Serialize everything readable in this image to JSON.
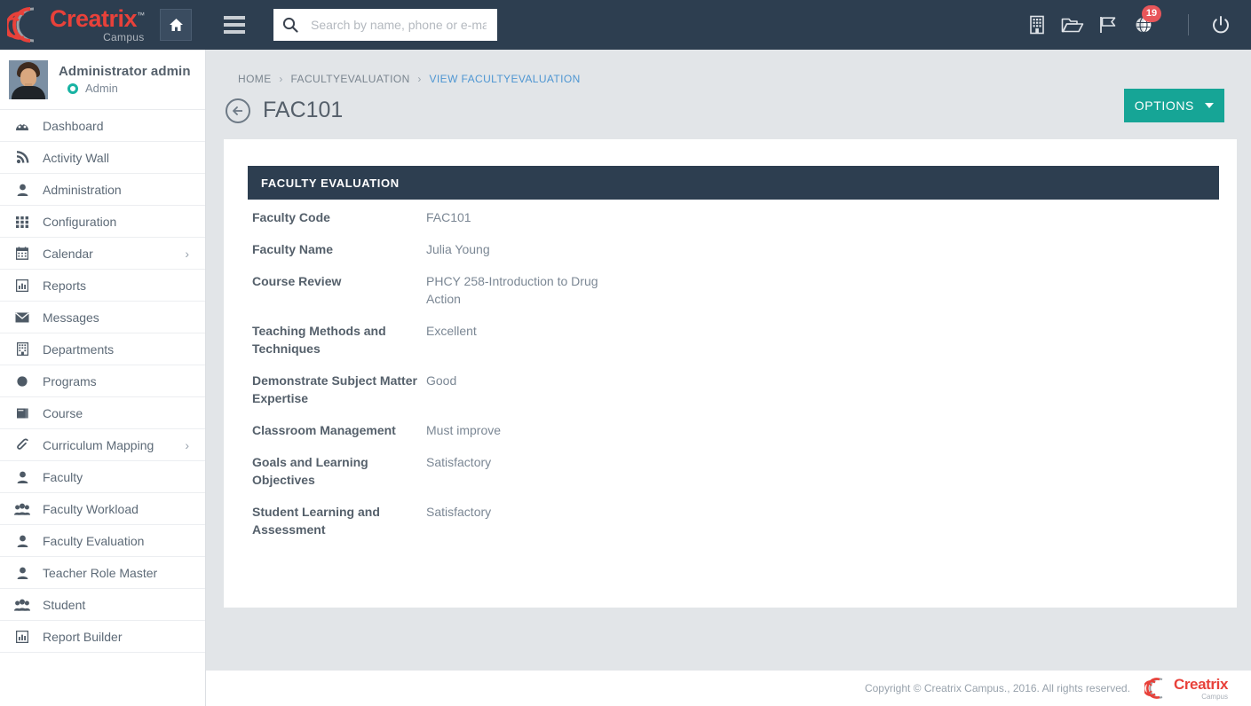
{
  "brand": {
    "name": "Creatrix",
    "tm": "™",
    "sub": "Campus",
    "accent_color": "#e8413a"
  },
  "topbar": {
    "background_color": "#2d3e50",
    "home_icon": "home-icon",
    "menu_icon": "hamburger-icon",
    "search": {
      "placeholder": "Search by name, phone or e-mail",
      "value": "",
      "icon": "search-icon"
    },
    "icons": [
      {
        "name": "building-icon",
        "label": "Institution"
      },
      {
        "name": "folder-open-icon",
        "label": "Documents"
      },
      {
        "name": "flag-icon",
        "label": "Flags"
      },
      {
        "name": "globe-notification-icon",
        "label": "Notifications",
        "badge": "19",
        "badge_color": "#e8565a"
      }
    ],
    "power_icon": "power-icon"
  },
  "sidebar": {
    "profile": {
      "name": "Administrator admin",
      "role": "Admin",
      "status_color": "#18b3a3",
      "avatar": "user-avatar"
    },
    "items": [
      {
        "label": "Dashboard",
        "icon": "dashboard-icon",
        "has_chevron": false
      },
      {
        "label": "Activity Wall",
        "icon": "rss-icon",
        "has_chevron": false
      },
      {
        "label": "Administration",
        "icon": "user-icon",
        "has_chevron": false
      },
      {
        "label": "Configuration",
        "icon": "grid-icon",
        "has_chevron": false
      },
      {
        "label": "Calendar",
        "icon": "calendar-icon",
        "has_chevron": true
      },
      {
        "label": "Reports",
        "icon": "bar-chart-icon",
        "has_chevron": false
      },
      {
        "label": "Messages",
        "icon": "envelope-icon",
        "has_chevron": false
      },
      {
        "label": "Departments",
        "icon": "building-icon",
        "has_chevron": false
      },
      {
        "label": "Programs",
        "icon": "circle-icon",
        "has_chevron": false
      },
      {
        "label": "Course",
        "icon": "book-icon",
        "has_chevron": false
      },
      {
        "label": "Curriculum Mapping",
        "icon": "paperclip-icon",
        "has_chevron": true
      },
      {
        "label": "Faculty",
        "icon": "user-icon",
        "has_chevron": false
      },
      {
        "label": "Faculty Workload",
        "icon": "users-icon",
        "has_chevron": false
      },
      {
        "label": "Faculty Evaluation",
        "icon": "user-icon",
        "has_chevron": false
      },
      {
        "label": "Teacher Role Master",
        "icon": "user-icon",
        "has_chevron": false
      },
      {
        "label": "Student",
        "icon": "users-icon",
        "has_chevron": false
      },
      {
        "label": "Report Builder",
        "icon": "bar-chart-icon",
        "has_chevron": false
      }
    ]
  },
  "breadcrumb": {
    "home": "HOME",
    "section": "FACULTYEVALUATION",
    "current": "VIEW FACULTYEVALUATION",
    "separator": "›",
    "current_color": "#4e96d2"
  },
  "page": {
    "title": "FAC101",
    "back_icon": "back-arrow-icon",
    "options_label": "OPTIONS",
    "options_color": "#16a596"
  },
  "card": {
    "header": "FACULTY EVALUATION",
    "header_color": "#2d3e50",
    "rows": [
      {
        "label": "Faculty Code",
        "value": "FAC101"
      },
      {
        "label": "Faculty Name",
        "value": "Julia Young"
      },
      {
        "label": "Course Review",
        "value": "PHCY 258-Introduction to Drug Action"
      },
      {
        "label": "Teaching Methods and Techniques",
        "value": "Excellent"
      },
      {
        "label": "Demonstrate Subject Matter Expertise",
        "value": "Good"
      },
      {
        "label": "Classroom Management",
        "value": "Must improve"
      },
      {
        "label": "Goals and Learning Objectives",
        "value": "Satisfactory"
      },
      {
        "label": "Student Learning and Assessment",
        "value": "Satisfactory"
      }
    ]
  },
  "footer": {
    "copyright": "Copyright © Creatrix Campus., 2016. All rights reserved.",
    "logo_name": "Creatrix",
    "logo_sub": "Campus"
  }
}
